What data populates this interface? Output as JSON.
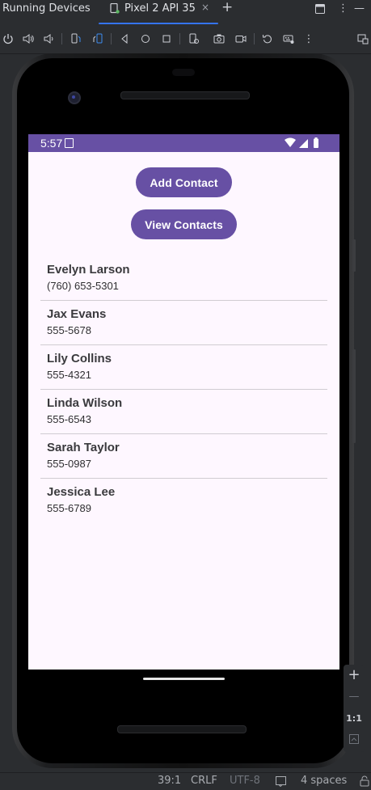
{
  "ide": {
    "panel_title": "Running Devices",
    "tab_label": "Pixel 2 API 35",
    "tab_close": "×",
    "add_tab": "+",
    "more": "⋮",
    "minimize": "—",
    "status": {
      "position": "39:1",
      "line_ending": "CRLF",
      "encoding": "UTF-8",
      "indent": "4 spaces"
    },
    "zoom": {
      "plus": "+",
      "minus": "—",
      "actual_size": "1:1"
    }
  },
  "toolbar_icons": [
    "power-icon",
    "volume-up-icon",
    "volume-down-icon",
    "rotate-left-icon",
    "rotate-right-icon",
    "back-icon",
    "home-icon",
    "overview-icon",
    "device-settings-icon",
    "screenshot-icon",
    "screen-record-icon",
    "reset-icon",
    "keyboard-icon",
    "more-icon",
    "window-icon"
  ],
  "device": {
    "status_bar": {
      "time": "5:57"
    },
    "buttons": {
      "add_contact": "Add Contact",
      "view_contacts": "View Contacts"
    },
    "contacts": [
      {
        "name": "Evelyn Larson",
        "phone": "(760) 653-5301"
      },
      {
        "name": "Jax Evans",
        "phone": "555-5678"
      },
      {
        "name": "Lily Collins",
        "phone": "555-4321"
      },
      {
        "name": "Linda Wilson",
        "phone": "555-6543"
      },
      {
        "name": "Sarah Taylor",
        "phone": "555-0987"
      },
      {
        "name": "Jessica Lee",
        "phone": "555-6789"
      }
    ]
  },
  "colors": {
    "accent": "#6750a4",
    "screen_bg": "#fef7ff",
    "ide_bg": "#2b2d30",
    "tab_underline": "#3574f0"
  }
}
